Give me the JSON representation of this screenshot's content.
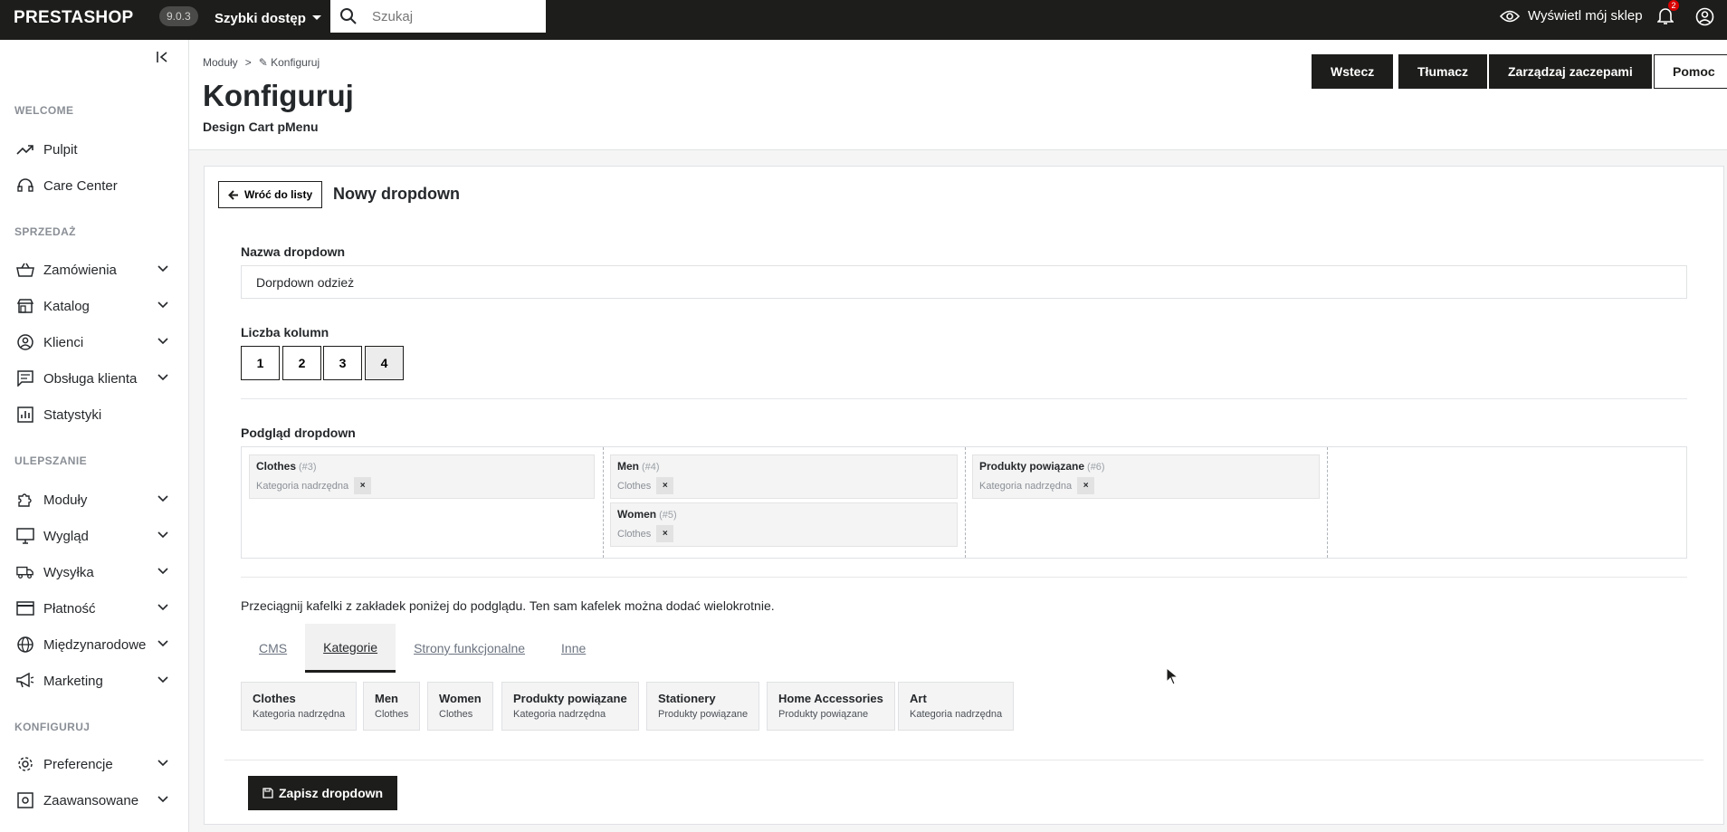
{
  "topbar": {
    "logo": "PRESTASHOP",
    "version": "9.0.3",
    "quick_access": "Szybki dostęp",
    "search_placeholder": "Szukaj",
    "view_shop": "Wyświetl mój sklep",
    "notifications_count": "2"
  },
  "sidebar": {
    "sections": {
      "welcome": "WELCOME",
      "sales": "SPRZEDAŻ",
      "improve": "ULEPSZANIE",
      "configure": "KONFIGURUJ"
    },
    "items": {
      "dashboard": "Pulpit",
      "care": "Care Center",
      "orders": "Zamówienia",
      "catalog": "Katalog",
      "customers": "Klienci",
      "service": "Obsługa klienta",
      "stats": "Statystyki",
      "modules": "Moduły",
      "design": "Wygląd",
      "shipping": "Wysyłka",
      "payment": "Płatność",
      "international": "Międzynarodowe",
      "marketing": "Marketing",
      "preferences": "Preferencje",
      "advanced": "Zaawansowane"
    }
  },
  "header": {
    "breadcrumb_parent": "Moduły",
    "breadcrumb_sep": ">",
    "breadcrumb_current": "Konfiguruj",
    "title": "Konfiguruj",
    "subtitle": "Design Cart pMenu",
    "buttons": {
      "back": "Wstecz",
      "translate": "Tłumacz",
      "hooks": "Zarządzaj zaczepami",
      "help": "Pomoc"
    }
  },
  "form": {
    "back_to_list": "Wróć do listy",
    "card_title": "Nowy dropdown",
    "name_label": "Nazwa dropdown",
    "name_value": "Dorpdown odzież",
    "columns_label": "Liczba kolumn",
    "columns_options": [
      "1",
      "2",
      "3",
      "4"
    ],
    "columns_selected": "4",
    "preview_label": "Podgląd dropdown",
    "preview_columns": [
      [
        {
          "title": "Clothes",
          "id": "(#3)",
          "subtitle": "Kategoria nadrzędna"
        }
      ],
      [
        {
          "title": "Men",
          "id": "(#4)",
          "subtitle": "Clothes"
        },
        {
          "title": "Women",
          "id": "(#5)",
          "subtitle": "Clothes"
        }
      ],
      [
        {
          "title": "Produkty powiązane",
          "id": "(#6)",
          "subtitle": "Kategoria nadrzędna"
        }
      ],
      []
    ],
    "remove_symbol": "×",
    "hint": "Przeciągnij kafelki z zakładek poniżej do podglądu. Ten sam kafelek można dodać wielokrotnie.",
    "tabs": [
      "CMS",
      "Kategorie",
      "Strony funkcjonalne",
      "Inne"
    ],
    "active_tab": "Kategorie",
    "palette": [
      {
        "title": "Clothes",
        "subtitle": "Kategoria nadrzędna"
      },
      {
        "title": "Men",
        "subtitle": "Clothes"
      },
      {
        "title": "Women",
        "subtitle": "Clothes"
      },
      {
        "title": "Produkty powiązane",
        "subtitle": "Kategoria nadrzędna"
      },
      {
        "title": "Stationery",
        "subtitle": "Produkty powiązane"
      },
      {
        "title": "Home Accessories",
        "subtitle": "Produkty powiązane"
      },
      {
        "title": "Art",
        "subtitle": "Kategoria nadrzędna"
      }
    ],
    "save_label": "Zapisz dropdown"
  },
  "colors": {
    "dark": "#1d1d1b",
    "badge": "#d90000",
    "tile_bg": "#f4f4f4"
  }
}
